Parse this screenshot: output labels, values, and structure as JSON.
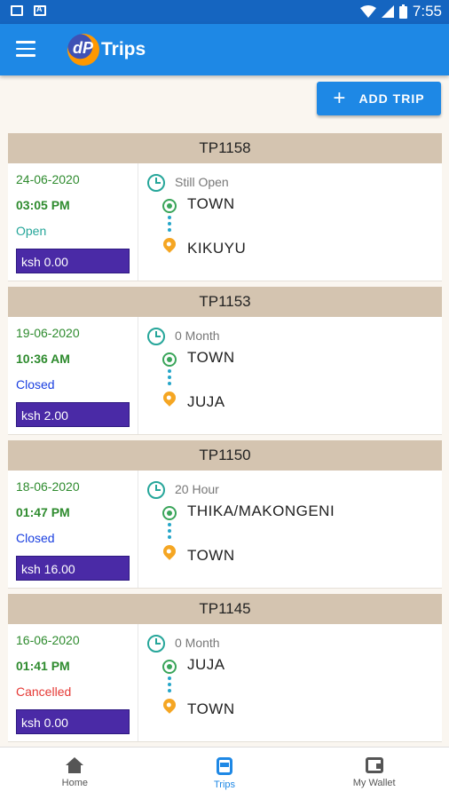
{
  "status_bar": {
    "time": "7:55"
  },
  "app_bar": {
    "title": "Trips",
    "logo_text": "dP"
  },
  "add_trip": {
    "label": "ADD TRIP"
  },
  "trips": [
    {
      "id": "TP1158",
      "date": "24-06-2020",
      "time": "03:05 PM",
      "status": "Open",
      "status_color": "#26a69a",
      "amount": "ksh 0.00",
      "duration": "Still Open",
      "origin": "TOWN",
      "destination": "KIKUYU"
    },
    {
      "id": "TP1153",
      "date": "19-06-2020",
      "time": "10:36 AM",
      "status": "Closed",
      "status_color": "#1a3fe0",
      "amount": "ksh 2.00",
      "duration": "0 Month",
      "origin": "TOWN",
      "destination": "JUJA"
    },
    {
      "id": "TP1150",
      "date": "18-06-2020",
      "time": "01:47 PM",
      "status": "Closed",
      "status_color": "#1a3fe0",
      "amount": "ksh 16.00",
      "duration": "20 Hour",
      "origin": "THIKA/MAKONGENI",
      "destination": "TOWN"
    },
    {
      "id": "TP1145",
      "date": "16-06-2020",
      "time": "01:41 PM",
      "status": "Cancelled",
      "status_color": "#e53935",
      "amount": "ksh 0.00",
      "duration": "0 Month",
      "origin": "JUJA",
      "destination": "TOWN"
    }
  ],
  "bottom_nav": {
    "items": [
      {
        "label": "Home",
        "icon": "home-icon"
      },
      {
        "label": "Trips",
        "icon": "bus-icon"
      },
      {
        "label": "My Wallet",
        "icon": "wallet-icon"
      }
    ]
  }
}
